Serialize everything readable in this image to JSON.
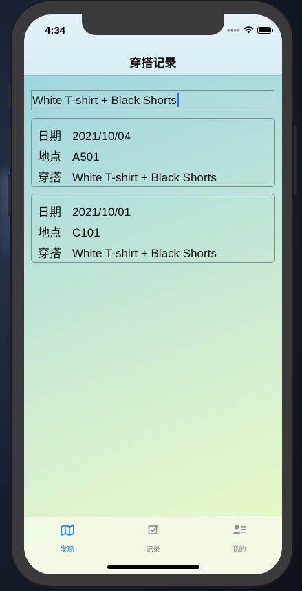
{
  "status": {
    "time": "4:34"
  },
  "nav": {
    "title": "穿搭记录"
  },
  "search": {
    "value": "White T-shirt + Black Shorts"
  },
  "records": [
    {
      "date_label": "日期",
      "date": "2021/10/04",
      "place_label": "地点",
      "place": "A501",
      "outfit_label": "穿搭",
      "outfit": "White T-shirt + Black Shorts"
    },
    {
      "date_label": "日期",
      "date": "2021/10/01",
      "place_label": "地点",
      "place": "C101",
      "outfit_label": "穿搭",
      "outfit": "White T-shirt + Black Shorts"
    }
  ],
  "tabs": [
    {
      "label": "发现",
      "icon": "map-icon",
      "active": true
    },
    {
      "label": "记录",
      "icon": "checkbox-icon",
      "active": false
    },
    {
      "label": "我的",
      "icon": "profile-icon",
      "active": false
    }
  ],
  "colors": {
    "accent": "#1b7cf0",
    "inactive": "#8e8e93"
  }
}
